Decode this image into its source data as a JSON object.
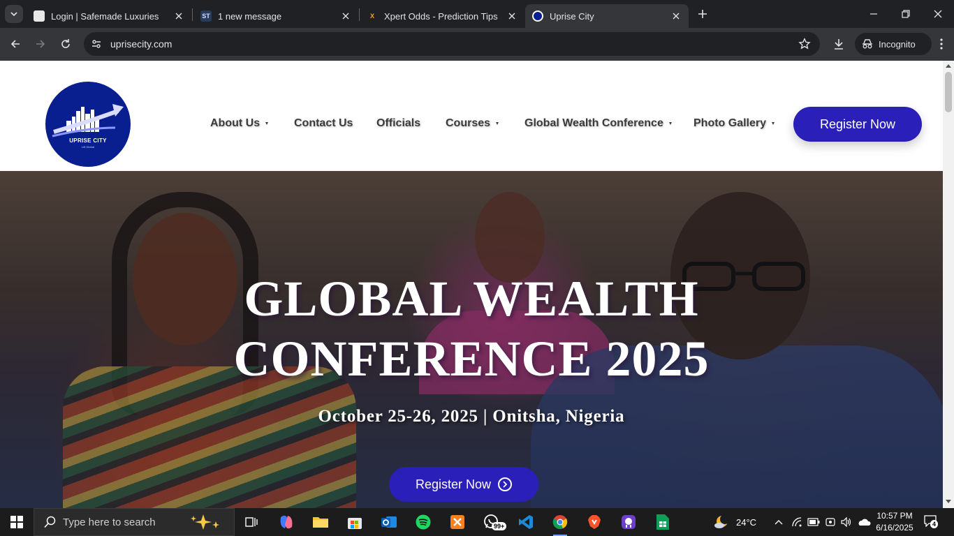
{
  "browser": {
    "tabs": [
      {
        "title": "Login | Safemade Luxuries",
        "fav_color": "#e8e8e8",
        "active": false
      },
      {
        "title": "1 new message",
        "fav_color": "#2a3c5c",
        "fav_text": "ST",
        "active": false
      },
      {
        "title": "Xpert Odds - Prediction Tips",
        "fav_color": "#202124",
        "fav_text": "X",
        "active": false
      },
      {
        "title": "Uprise City",
        "fav_color": "#0a1f8f",
        "active": true
      }
    ],
    "url": "uprisecity.com",
    "incognito_label": "Incognito"
  },
  "site": {
    "logo": {
      "text": "UPRISE CITY",
      "sub": "Lift Global"
    },
    "nav": [
      {
        "label": "About Us",
        "dropdown": true
      },
      {
        "label": "Contact Us",
        "dropdown": false
      },
      {
        "label": "Officials",
        "dropdown": false
      },
      {
        "label": "Courses",
        "dropdown": true
      },
      {
        "label": "Global Wealth Conference",
        "dropdown": true
      },
      {
        "label": "Photo Gallery",
        "dropdown": true
      }
    ],
    "header_cta": "Register Now",
    "hero": {
      "title_line1": "GLOBAL WEALTH",
      "title_line2": "CONFERENCE 2025",
      "subtitle": "October 25-26, 2025 | Onitsha, Nigeria",
      "cta": "Register Now"
    },
    "brand_color": "#2a1fb8"
  },
  "taskbar": {
    "search_placeholder": "Type here to search",
    "whatsapp_badge": "99+",
    "weather": "24°C",
    "time": "10:57 PM",
    "date": "6/16/2025",
    "notifications": "4"
  }
}
